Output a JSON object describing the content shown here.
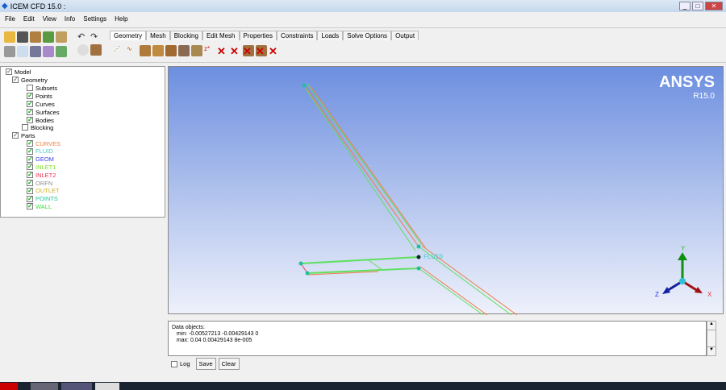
{
  "window": {
    "title": "ICEM CFD 15.0 :"
  },
  "menu": [
    "File",
    "Edit",
    "View",
    "Info",
    "Settings",
    "Help"
  ],
  "tabs": [
    "Geometry",
    "Mesh",
    "Blocking",
    "Edit Mesh",
    "Properties",
    "Constraints",
    "Loads",
    "Solve Options",
    "Output"
  ],
  "tree": {
    "model": "Model",
    "geometry": "Geometry",
    "geometry_items": [
      {
        "label": "Subsets",
        "checked": false
      },
      {
        "label": "Points",
        "checked": true
      },
      {
        "label": "Curves",
        "checked": true
      },
      {
        "label": "Surfaces",
        "checked": true
      },
      {
        "label": "Bodies",
        "checked": true
      }
    ],
    "blocking": "Blocking",
    "parts": "Parts",
    "part_items": [
      {
        "label": "CURVES",
        "color": "#f08040"
      },
      {
        "label": "FLUID",
        "color": "#40c8c8"
      },
      {
        "label": "GEOM",
        "color": "#4040f0"
      },
      {
        "label": "INLET1",
        "color": "#80e020"
      },
      {
        "label": "INLET2",
        "color": "#f03050"
      },
      {
        "label": "ORFN",
        "color": "#909090"
      },
      {
        "label": "OUTLET",
        "color": "#d0b020"
      },
      {
        "label": "POINTS",
        "color": "#20c8a0"
      },
      {
        "label": "WALL",
        "color": "#40e040"
      }
    ]
  },
  "viewport": {
    "brand": "ANSYS",
    "version": "R15.0",
    "point_label": "FLUID",
    "axes": {
      "x": "X",
      "y": "Y",
      "z": "Z"
    }
  },
  "messages": {
    "lines": [
      "Data objects:",
      "   min: -0.00527213 -0.00429143 0",
      "   max: 0.04 0.00429143 8e-005"
    ],
    "log_label": "Log",
    "save_label": "Save",
    "clear_label": "Clear"
  }
}
